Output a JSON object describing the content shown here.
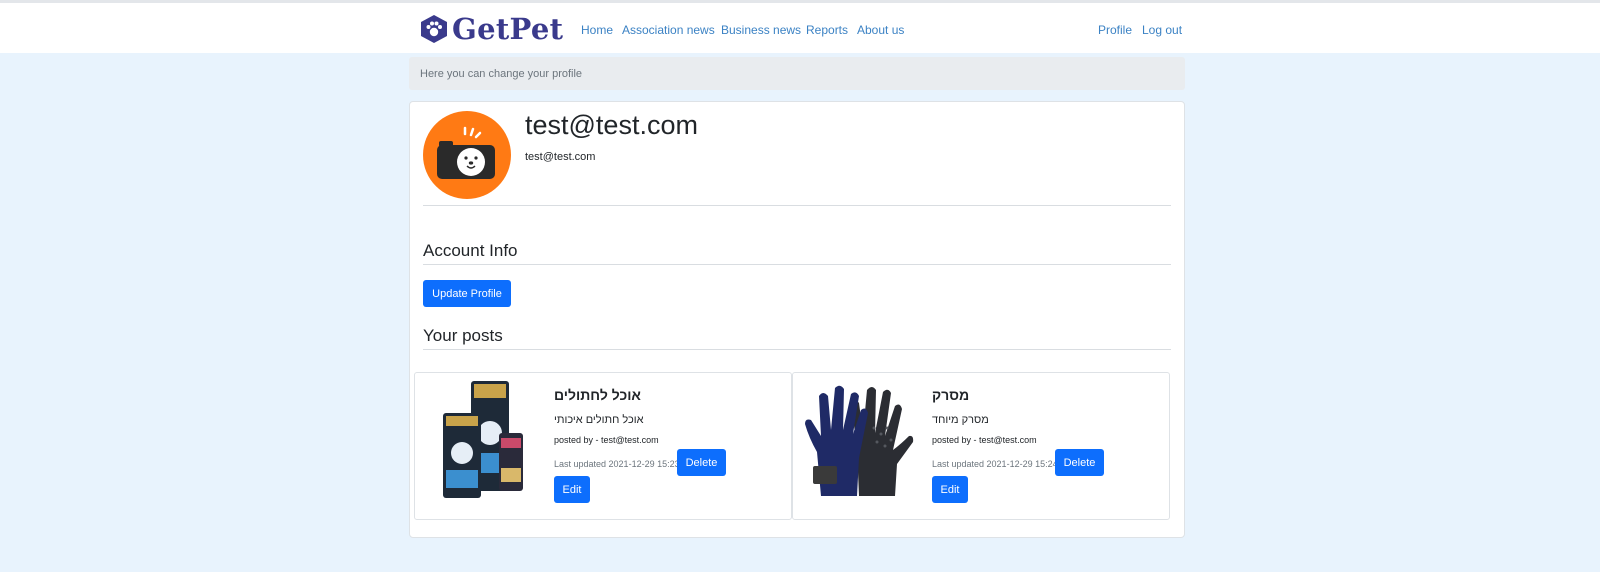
{
  "nav": {
    "brand": "GetPet",
    "links": [
      "Home",
      "Association news",
      "Business news",
      "Reports",
      "About us"
    ],
    "right_links": [
      "Profile",
      "Log out"
    ]
  },
  "breadcrumb": {
    "text": "Here you can change your profile"
  },
  "profile": {
    "name": "test@test.com",
    "email": "test@test.com",
    "avatar_icon": "camera-dog-icon",
    "avatar_color": "#ff7a14"
  },
  "sections": {
    "account_info": "Account Info",
    "update_button": "Update Profile",
    "your_posts": "Your posts"
  },
  "posts": [
    {
      "title": "אוכל לחתולים",
      "description": "אוכל חתולים איכותי",
      "posted_by": "posted by - test@test.com",
      "last_updated": "Last updated 2021-12-29 15:23",
      "delete_label": "Delete",
      "edit_label": "Edit",
      "image_icon": "cat-food-bags-image"
    },
    {
      "title": "מסרק",
      "description": "מסרק מיוחד",
      "posted_by": "posted by - test@test.com",
      "last_updated": "Last updated 2021-12-29 15:24",
      "delete_label": "Delete",
      "edit_label": "Edit",
      "image_icon": "grooming-gloves-image"
    }
  ],
  "colors": {
    "primary": "#0d6efd",
    "nav_link": "#3b82c4",
    "brand": "#3a3a8c",
    "page_bg": "#e8f3fd"
  }
}
